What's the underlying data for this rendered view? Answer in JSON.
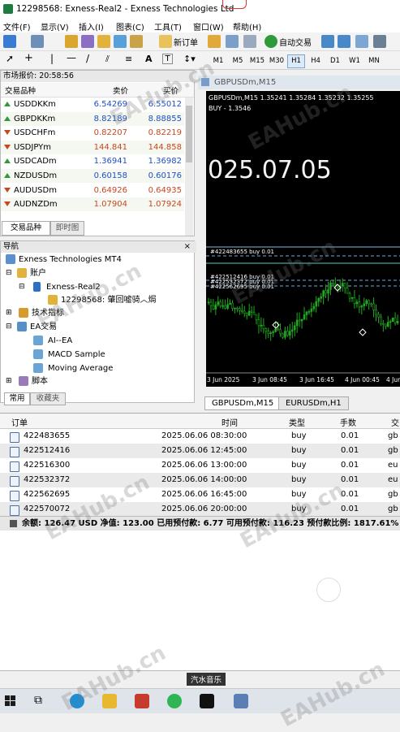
{
  "window": {
    "title": "12298568: Exness-Real2 - Exness Technologies Ltd"
  },
  "menu": [
    "文件(F)",
    "显示(V)",
    "插入(I)",
    "图表(C)",
    "工具(T)",
    "窗口(W)",
    "帮助(H)"
  ],
  "toolbar": {
    "new_order": "新订单",
    "auto_trading": "自动交易"
  },
  "timeframes": [
    "M1",
    "M5",
    "M15",
    "M30",
    "H1",
    "H4",
    "D1",
    "W1",
    "MN"
  ],
  "timeframe_active": "H1",
  "market_watch": {
    "header": "市场报价: 20:58:56",
    "col_symbol": "交易品种",
    "col_bid": "卖价",
    "col_ask": "买价",
    "rows": [
      {
        "symbol": "USDDKKm",
        "bid": "6.54269",
        "ask": "6.55012",
        "dir": "up"
      },
      {
        "symbol": "GBPDKKm",
        "bid": "8.82189",
        "ask": "8.88855",
        "dir": "up"
      },
      {
        "symbol": "USDCHFm",
        "bid": "0.82207",
        "ask": "0.82219",
        "dir": "down"
      },
      {
        "symbol": "USDJPYm",
        "bid": "144.841",
        "ask": "144.858",
        "dir": "down"
      },
      {
        "symbol": "USDCADm",
        "bid": "1.36941",
        "ask": "1.36982",
        "dir": "up"
      },
      {
        "symbol": "NZDUSDm",
        "bid": "0.60158",
        "ask": "0.60176",
        "dir": "up"
      },
      {
        "symbol": "AUDUSDm",
        "bid": "0.64926",
        "ask": "0.64935",
        "dir": "down"
      },
      {
        "symbol": "AUDNZDm",
        "bid": "1.07904",
        "ask": "1.07924",
        "dir": "down"
      }
    ],
    "tabs": [
      "交易品种",
      "即时图"
    ]
  },
  "navigator": {
    "header": "导航",
    "root": "Exness Technologies MT4",
    "accounts": "账户",
    "server": "Exness-Real2",
    "account": "12298568: 肇回嘘骑︿焗",
    "indicators": "技术指标",
    "ea": "EA交易",
    "ea_items": [
      "AI--EA",
      "MACD Sample",
      "Moving Average"
    ],
    "scripts": "脚本",
    "tabs": [
      "常用",
      "收藏夹"
    ]
  },
  "chart": {
    "window_title": "GBPUSDm,M15",
    "info_line": "GBPUSDm,M15  1.35241 1.35284 1.35232 1.35255",
    "buy_label": "BUY - 1.3546",
    "date_overlay": "025.07.05",
    "order_labels": [
      "#422483655 buy 0.01",
      "#422512416 buy 0.01",
      "#422532372 buy 0.01",
      "#422562695 buy 0.01"
    ],
    "x_ticks": [
      "3 Jun 2025",
      "3 Jun 08:45",
      "3 Jun 16:45",
      "4 Jun 00:45",
      "4 Jun"
    ],
    "tabs": [
      "GBPUSDm,M15",
      "EURUSDm,H1"
    ]
  },
  "terminal": {
    "columns": [
      "订单",
      "时间",
      "类型",
      "手数",
      "交"
    ],
    "orders": [
      {
        "ticket": "422483655",
        "time": "2025.06.06 08:30:00",
        "type": "buy",
        "lots": "0.01",
        "sym": "gb"
      },
      {
        "ticket": "422512416",
        "time": "2025.06.06 12:45:00",
        "type": "buy",
        "lots": "0.01",
        "sym": "gb"
      },
      {
        "ticket": "422516300",
        "time": "2025.06.06 13:00:00",
        "type": "buy",
        "lots": "0.01",
        "sym": "eu"
      },
      {
        "ticket": "422532372",
        "time": "2025.06.06 14:00:00",
        "type": "buy",
        "lots": "0.01",
        "sym": "eu"
      },
      {
        "ticket": "422562695",
        "time": "2025.06.06 16:45:00",
        "type": "buy",
        "lots": "0.01",
        "sym": "gb"
      },
      {
        "ticket": "422570072",
        "time": "2025.06.06 20:00:00",
        "type": "buy",
        "lots": "0.01",
        "sym": "gb"
      }
    ],
    "summary": "余额: 126.47 USD  净值: 123.00  已用预付款: 6.77  可用预付款: 116.23  预付款比例: 1817.61%"
  },
  "music_tooltip": "汽水音乐",
  "watermark": "EAHub.cn",
  "colors": {
    "bid": "#1f4fc4",
    "ask_up": "#1f4fc4",
    "down": "#c8461e",
    "candle": "#1faa1f",
    "chart_bg": "#000000"
  }
}
